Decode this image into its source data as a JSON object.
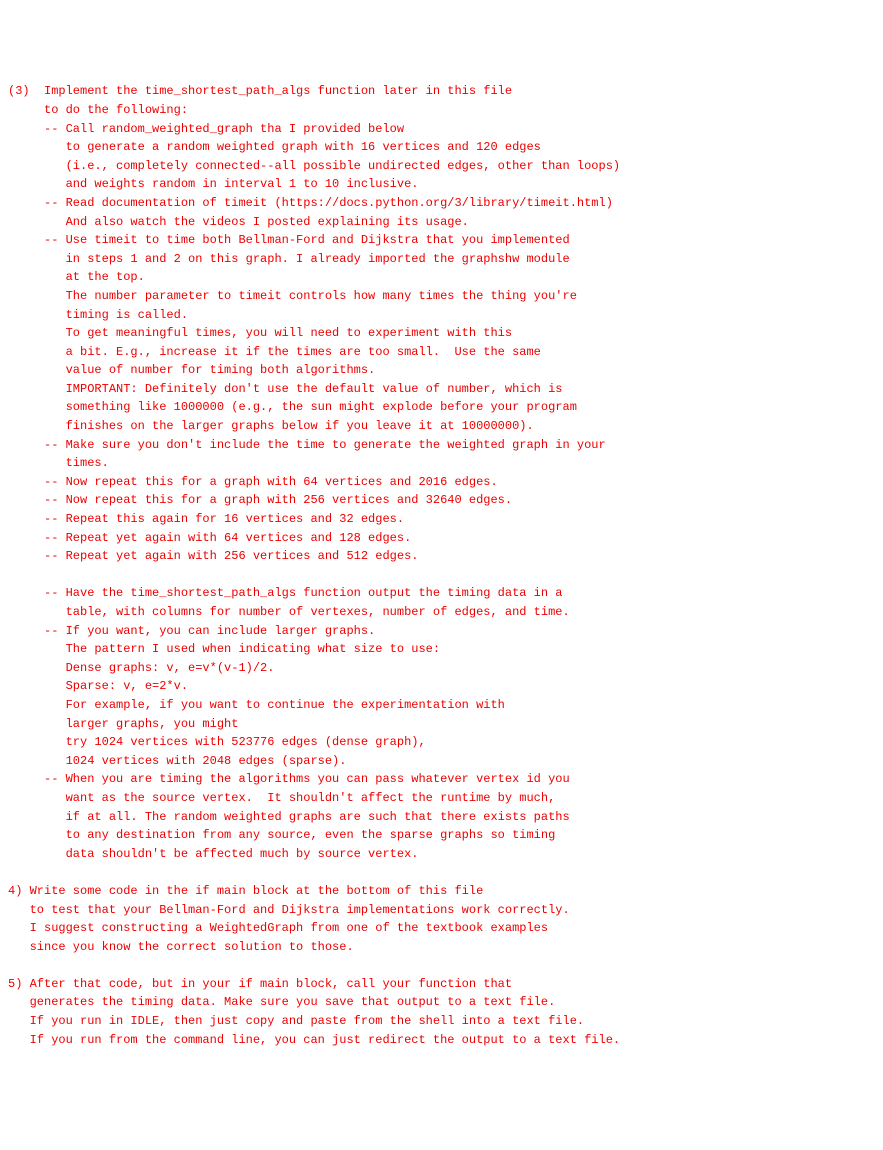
{
  "lines": [
    "(3)  Implement the time_shortest_path_algs function later in this file",
    "     to do the following:",
    "     -- Call random_weighted_graph tha I provided below",
    "        to generate a random weighted graph with 16 vertices and 120 edges",
    "        (i.e., completely connected--all possible undirected edges, other than loops)",
    "        and weights random in interval 1 to 10 inclusive.",
    "     -- Read documentation of timeit (https://docs.python.org/3/library/timeit.html)",
    "        And also watch the videos I posted explaining its usage.",
    "     -- Use timeit to time both Bellman-Ford and Dijkstra that you implemented",
    "        in steps 1 and 2 on this graph. I already imported the graphshw module",
    "        at the top.",
    "        The number parameter to timeit controls how many times the thing you're",
    "        timing is called.",
    "        To get meaningful times, you will need to experiment with this",
    "        a bit. E.g., increase it if the times are too small.  Use the same",
    "        value of number for timing both algorithms.",
    "        IMPORTANT: Definitely don't use the default value of number, which is",
    "        something like 1000000 (e.g., the sun might explode before your program",
    "        finishes on the larger graphs below if you leave it at 10000000).",
    "     -- Make sure you don't include the time to generate the weighted graph in your",
    "        times.",
    "     -- Now repeat this for a graph with 64 vertices and 2016 edges.",
    "     -- Now repeat this for a graph with 256 vertices and 32640 edges.",
    "     -- Repeat this again for 16 vertices and 32 edges.",
    "     -- Repeat yet again with 64 vertices and 128 edges.",
    "     -- Repeat yet again with 256 vertices and 512 edges.",
    "",
    "     -- Have the time_shortest_path_algs function output the timing data in a",
    "        table, with columns for number of vertexes, number of edges, and time.",
    "     -- If you want, you can include larger graphs.",
    "        The pattern I used when indicating what size to use:",
    "        Dense graphs: v, e=v*(v-1)/2.",
    "        Sparse: v, e=2*v.",
    "        For example, if you want to continue the experimentation with",
    "        larger graphs, you might",
    "        try 1024 vertices with 523776 edges (dense graph),",
    "        1024 vertices with 2048 edges (sparse).",
    "     -- When you are timing the algorithms you can pass whatever vertex id you",
    "        want as the source vertex.  It shouldn't affect the runtime by much,",
    "        if at all. The random weighted graphs are such that there exists paths",
    "        to any destination from any source, even the sparse graphs so timing",
    "        data shouldn't be affected much by source vertex.",
    "",
    "4) Write some code in the if main block at the bottom of this file",
    "   to test that your Bellman-Ford and Dijkstra implementations work correctly.",
    "   I suggest constructing a WeightedGraph from one of the textbook examples",
    "   since you know the correct solution to those.",
    "",
    "5) After that code, but in your if main block, call your function that",
    "   generates the timing data. Make sure you save that output to a text file.",
    "   If you run in IDLE, then just copy and paste from the shell into a text file.",
    "   If you run from the command line, you can just redirect the output to a text file."
  ]
}
